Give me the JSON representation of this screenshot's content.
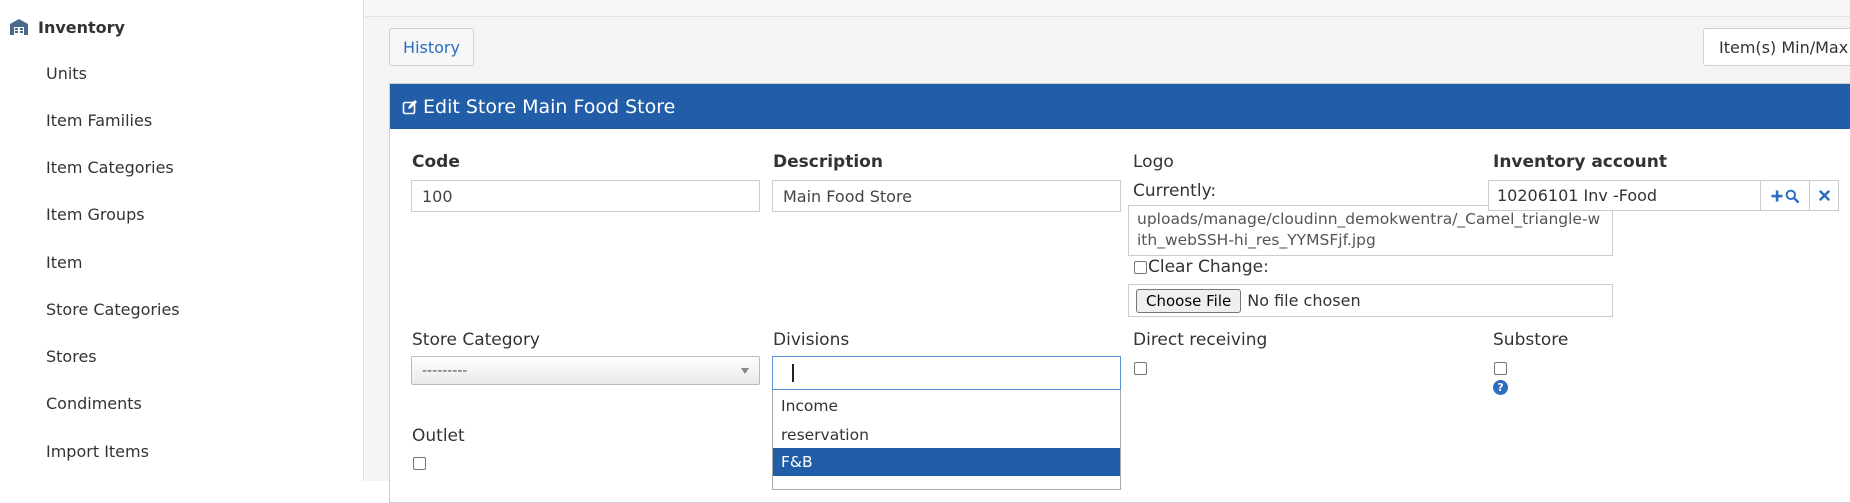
{
  "sidebar": {
    "section_title": "Inventory",
    "items": [
      {
        "label": "Units"
      },
      {
        "label": "Item Families"
      },
      {
        "label": "Item Categories"
      },
      {
        "label": "Item Groups"
      },
      {
        "label": "Item"
      },
      {
        "label": "Store Categories"
      },
      {
        "label": "Stores"
      },
      {
        "label": "Condiments"
      },
      {
        "label": "Import Items"
      }
    ]
  },
  "toolbar": {
    "history_label": "History",
    "minmax_label": "Item(s) Min/Max"
  },
  "panel": {
    "title": "Edit Store Main Food Store"
  },
  "form": {
    "code": {
      "label": "Code",
      "value": "100"
    },
    "description": {
      "label": "Description",
      "value": "Main Food Store"
    },
    "logo": {
      "label": "Logo",
      "currently_label": "Currently:",
      "current_path": "uploads/manage/cloudinn_demokwentra/_Camel_triangle-with_webSSH-hi_res_YYMSFjf.jpg",
      "clear_label": "Clear",
      "change_label": "Change:",
      "choose_file_label": "Choose File",
      "no_file_text": "No file chosen"
    },
    "inventory_account": {
      "label": "Inventory account",
      "value": "10206101 Inv -Food"
    },
    "store_category": {
      "label": "Store Category",
      "selected": "---------"
    },
    "divisions": {
      "label": "Divisions",
      "search_value": "",
      "options": [
        {
          "label": "Income",
          "selected": false
        },
        {
          "label": "reservation",
          "selected": false
        },
        {
          "label": "F&B",
          "selected": true
        }
      ]
    },
    "direct_receiving": {
      "label": "Direct receiving",
      "checked": false
    },
    "substore": {
      "label": "Substore",
      "checked": false
    },
    "outlet": {
      "label": "Outlet",
      "checked": false
    }
  },
  "colors": {
    "header_blue": "#225ea8",
    "link_blue": "#2a6ebd"
  },
  "icons": {
    "sidebar_section": "warehouse-icon",
    "panel_title": "edit-icon",
    "account_add": "plus-icon",
    "account_search": "search-icon",
    "account_clear": "close-icon",
    "substore_help": "help-icon"
  }
}
